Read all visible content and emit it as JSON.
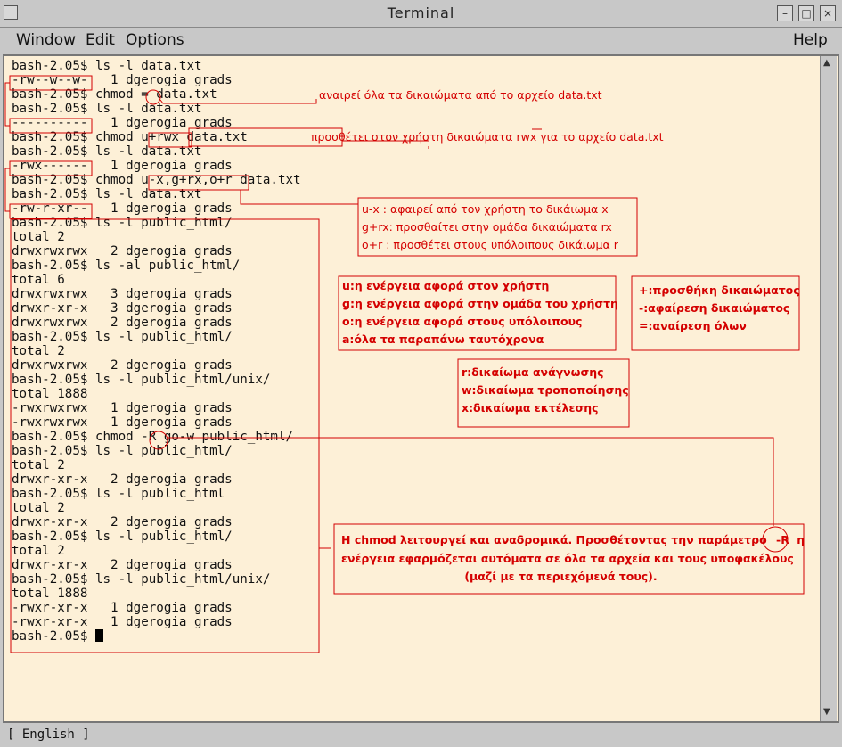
{
  "window": {
    "title": "Terminal",
    "minimize": "–",
    "maximize": "□",
    "close": "×"
  },
  "menu": {
    "window": "Window",
    "edit": "Edit",
    "options": "Options",
    "help": "Help"
  },
  "terminal_lines": [
    "bash-2.05$ ls -l data.txt",
    "-rw--w--w-   1 dgerogia grads",
    "bash-2.05$ chmod = data.txt",
    "bash-2.05$ ls -l data.txt",
    "----------   1 dgerogia grads",
    "bash-2.05$ chmod u+rwx data.txt",
    "bash-2.05$ ls -l data.txt",
    "-rwx------   1 dgerogia grads",
    "bash-2.05$ chmod u-x,g+rx,o+r data.txt",
    "bash-2.05$ ls -l data.txt",
    "-rw-r-xr--   1 dgerogia grads",
    "bash-2.05$ ls -l public_html/",
    "total 2",
    "drwxrwxrwx   2 dgerogia grads",
    "bash-2.05$ ls -al public_html/",
    "total 6",
    "drwxrwxrwx   3 dgerogia grads",
    "drwxr-xr-x   3 dgerogia grads",
    "drwxrwxrwx   2 dgerogia grads",
    "bash-2.05$ ls -l public_html/",
    "total 2",
    "drwxrwxrwx   2 dgerogia grads",
    "bash-2.05$ ls -l public_html/unix/",
    "total 1888",
    "-rwxrwxrwx   1 dgerogia grads",
    "-rwxrwxrwx   1 dgerogia grads",
    "bash-2.05$ chmod -R go-w public_html/",
    "bash-2.05$ ls -l public_html/",
    "total 2",
    "drwxr-xr-x   2 dgerogia grads",
    "bash-2.05$ ls -l public_html",
    "total 2",
    "drwxr-xr-x   2 dgerogia grads",
    "bash-2.05$ ls -l public_html/",
    "total 2",
    "drwxr-xr-x   2 dgerogia grads",
    "bash-2.05$ ls -l public_html/unix/",
    "total 1888",
    "-rwxr-xr-x   1 dgerogia grads",
    "-rwxr-xr-x   1 dgerogia grads"
  ],
  "prompt": "bash-2.05$ ",
  "annotations": {
    "equals_note": "αναιρεί όλα τα δικαιώματα από το αρχείο data.txt",
    "urwx_note": "προσθέτει στον χρήστη δικαιώματα rwx για το αρχείο data.txt",
    "multi_note": [
      "u-x : αφαιρεί από τον χρήστη το δικάιωμα x",
      "g+rx: προσθαίτει στην ομάδα δικαιώματα rx",
      "o+r : προσθέτει στους υπόλοιπους δικάιωμα r"
    ],
    "who_note": [
      "u:η ενέργεια αφορά στον χρήστη",
      "g:η ενέργεια αφορά στην ομάδα του χρήστη",
      "o:η ενέργεια αφορά στους υπόλοιπους",
      "a:όλα τα παραπάνω ταυτόχρονα"
    ],
    "op_note": [
      "+:προσθήκη δικαιώματος",
      "-:αφαίρεση δικαιώματος",
      "=:αναίρεση όλων"
    ],
    "perm_note": [
      "r:δικαίωμα ανάγνωσης",
      "w:δικαίωμα τροποποίησης",
      "x:δικαίωμα εκτέλεσης"
    ],
    "recursive_note": {
      "line1_a": "Η chmod λειτουργεί και αναδρομικά. Προσθέτοντας την παράμετρο",
      "param": "-R",
      "line1_b": "η",
      "line2": "ενέργεια εφαρμόζεται αυτόματα σε όλα τα αρχεία και τους υποφακέλους",
      "line3": "(μαζί με τα περιεχόμενά τους)."
    }
  },
  "status": {
    "input_method": "[ English ]"
  },
  "colors": {
    "annotation": "#d40000",
    "terminal_bg": "#fdf0d7",
    "chrome": "#c8c8c8"
  }
}
